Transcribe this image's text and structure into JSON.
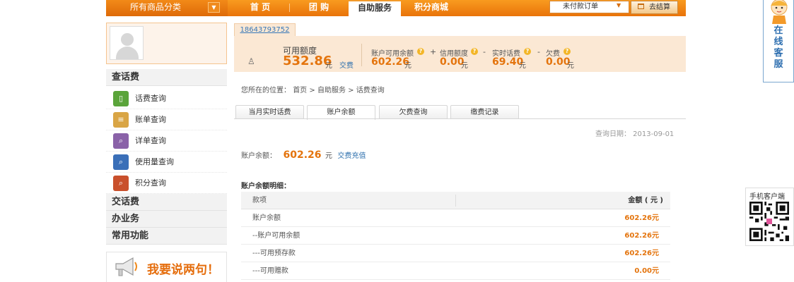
{
  "nav": {
    "category_label": "所有商品分类",
    "items": [
      "首 页",
      "团 购",
      "自助服务",
      "积分商城"
    ],
    "active_index": 2,
    "order_select": "未付款订单",
    "cart_label": "去结算"
  },
  "sidebar": {
    "sections": [
      {
        "title": "查话费",
        "items": [
          "话费查询",
          "账单查询",
          "详单查询",
          "使用量查询",
          "积分查询"
        ]
      },
      {
        "title": "交话费"
      },
      {
        "title": "办业务"
      },
      {
        "title": "常用功能"
      }
    ],
    "speak_label": "我要说两句！"
  },
  "account": {
    "phone": "18643793752",
    "available_label": "可用额度",
    "available_value": "532.86",
    "available_unit": "元",
    "pay_link": "交费",
    "balance_label": "账户可用余额",
    "balance_value": "602.26",
    "plus": "+",
    "credit_label": "信用额度",
    "credit_value": "0.00",
    "minus1": "-",
    "realtime_label": "实时话费",
    "realtime_value": "69.40",
    "minus2": "-",
    "owed_label": "欠费",
    "owed_value": "0.00",
    "unit": "元"
  },
  "breadcrumb": {
    "prefix": "您所在的位置：",
    "items": [
      "首页",
      "自助服务",
      "话费查询"
    ],
    "sep": ">"
  },
  "tabs": [
    "当月实时话费",
    "账户余额",
    "欠费查询",
    "缴费记录"
  ],
  "active_tab": 1,
  "query_date": "查询日期： 2013-09-01",
  "balance": {
    "label": "账户余额：",
    "value": "602.26",
    "unit": "元",
    "link": "交费充值"
  },
  "detail": {
    "title": "账户余额明细：",
    "col_item": "款项",
    "col_amount": "金额 ( 元 )",
    "rows": [
      {
        "name": "账户余额",
        "amount": "602.26元"
      },
      {
        "name": "--账户可用余额",
        "amount": "602.26元"
      },
      {
        "name": "---可用预存款",
        "amount": "602.26元"
      },
      {
        "name": "---可用赠款",
        "amount": "0.00元"
      }
    ]
  },
  "online_service": "在线客服",
  "mobile_client": "手机客户端"
}
